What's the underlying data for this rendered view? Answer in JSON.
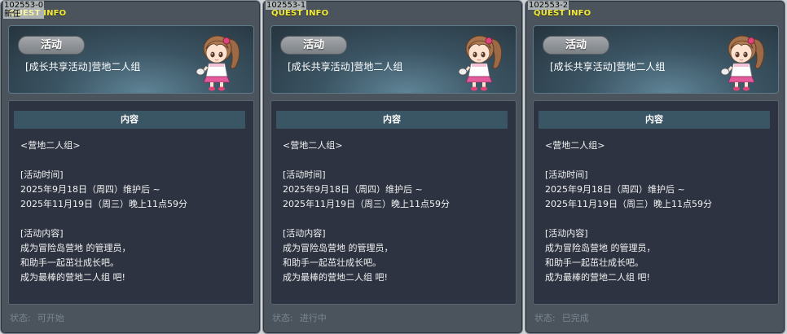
{
  "panels": [
    {
      "id": "102553-0",
      "id_overlay": "新任",
      "window_title": "QUEST INFO",
      "tag": "活动",
      "quest_name": "[成长共享活动]营地二人组",
      "content_header": "内容",
      "content_lines": [
        "<营地二人组>",
        "",
        "[活动时间]",
        "2025年9月18日（周四）维护后 ~",
        "2025年11月19日（周三）晚上11点59分",
        "",
        "[活动内容]",
        "成为冒险岛营地 的管理员，",
        "和助手一起茁壮成长吧。",
        "成为最棒的营地二人组 吧!"
      ],
      "status_label": "状态:",
      "status_value": "可开始"
    },
    {
      "id": "102553-1",
      "window_title": "QUEST INFO",
      "tag": "活动",
      "quest_name": "[成长共享活动]营地二人组",
      "content_header": "内容",
      "content_lines": [
        "<营地二人组>",
        "",
        "[活动时间]",
        "2025年9月18日（周四）维护后 ~",
        "2025年11月19日（周三）晚上11点59分",
        "",
        "[活动内容]",
        "成为冒险岛营地 的管理员，",
        "和助手一起茁壮成长吧。",
        "成为最棒的营地二人组 吧!"
      ],
      "status_label": "状态:",
      "status_value": "进行中"
    },
    {
      "id": "102553-2",
      "window_title": "QUEST INFO",
      "tag": "活动",
      "quest_name": "[成长共享活动]营地二人组",
      "content_header": "内容",
      "content_lines": [
        "<营地二人组>",
        "",
        "[活动时间]",
        "2025年9月18日（周四）维护后 ~",
        "2025年11月19日（周三）晚上11点59分",
        "",
        "[活动内容]",
        "成为冒险岛营地 的管理员，",
        "和助手一起茁壮成长吧。",
        "成为最棒的营地二人组 吧!"
      ],
      "status_label": "状态:",
      "status_value": "已完成"
    }
  ],
  "icons": {
    "character": "npc-girl-portrait-icon"
  },
  "colors": {
    "window_title": "#f2ea3c",
    "panel_bg": "#4b545c",
    "content_bg": "#2d3340",
    "content_header_bg": "#3a5563",
    "status_text": "#7a8692"
  }
}
